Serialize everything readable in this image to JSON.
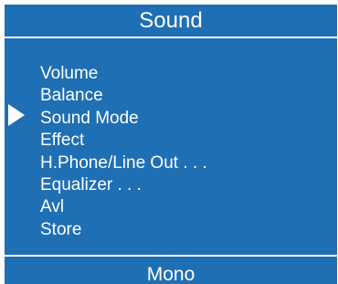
{
  "header": {
    "title": "Sound"
  },
  "menu": {
    "items": [
      {
        "label": "Volume"
      },
      {
        "label": "Balance"
      },
      {
        "label": "Sound Mode",
        "selected": true
      },
      {
        "label": "Effect"
      },
      {
        "label": "H.Phone/Line Out . . ."
      },
      {
        "label": "Equalizer . . ."
      },
      {
        "label": "Avl"
      },
      {
        "label": "Store"
      }
    ],
    "pointer_icon": "triangle-right-icon"
  },
  "status": {
    "mode": "Mono"
  },
  "colors": {
    "panel": "#1f6fb4",
    "text": "#ffffff",
    "background": "#ffffff"
  }
}
